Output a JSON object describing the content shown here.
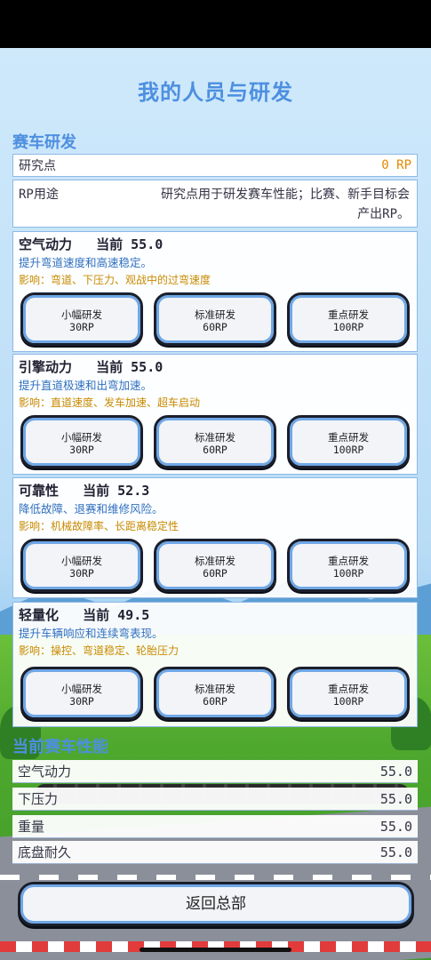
{
  "title": "我的人员与研发",
  "rd_section": {
    "title": "赛车研发",
    "points_label": "研究点",
    "points_value": "0 RP",
    "use_label": "RP用途",
    "use_text": "研究点用于研发赛车性能；比赛、新手目标会产出RP。"
  },
  "cards": [
    {
      "name": "空气动力",
      "current": "当前 55.0",
      "desc": "提升弯道速度和高速稳定。",
      "impact": "影响：弯道、下压力、观战中的过弯速度"
    },
    {
      "name": "引擎动力",
      "current": "当前 55.0",
      "desc": "提升直道极速和出弯加速。",
      "impact": "影响：直道速度、发车加速、超车启动"
    },
    {
      "name": "可靠性",
      "current": "当前 52.3",
      "desc": "降低故障、退赛和维修风险。",
      "impact": "影响：机械故障率、长距离稳定性"
    },
    {
      "name": "轻量化",
      "current": "当前 49.5",
      "desc": "提升车辆响应和连续弯表现。",
      "impact": "影响：操控、弯道稳定、轮胎压力"
    }
  ],
  "buttons": [
    {
      "label": "小幅研发",
      "cost": "30RP"
    },
    {
      "label": "标准研发",
      "cost": "60RP"
    },
    {
      "label": "重点研发",
      "cost": "100RP"
    }
  ],
  "performance": {
    "title": "当前赛车性能",
    "rows": [
      {
        "label": "空气动力",
        "value": "55.0"
      },
      {
        "label": "下压力",
        "value": "55.0"
      },
      {
        "label": "重量",
        "value": "55.0"
      },
      {
        "label": "底盘耐久",
        "value": "55.0"
      }
    ]
  },
  "back_label": "返回总部"
}
